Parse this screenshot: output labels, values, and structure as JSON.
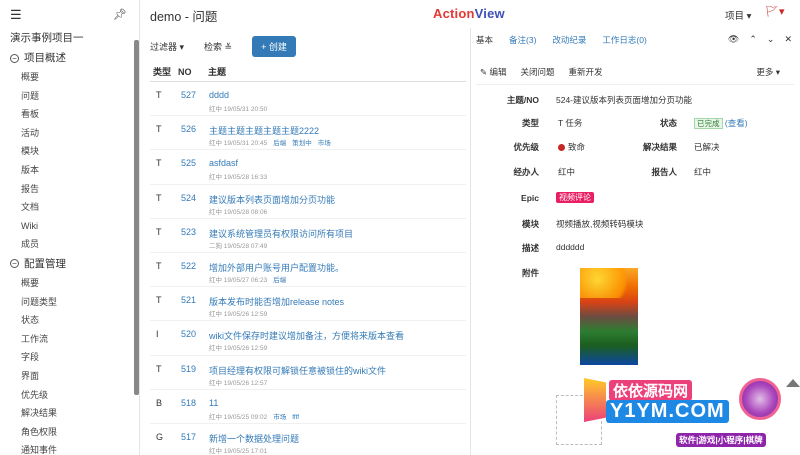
{
  "sidebar": {
    "project_title": "演示事例项目一",
    "sections": [
      {
        "title": "项目概述",
        "items": [
          "概要",
          "问题",
          "看板",
          "活动",
          "模块",
          "版本",
          "报告",
          "文档",
          "Wiki",
          "成员"
        ]
      },
      {
        "title": "配置管理",
        "items": [
          "概要",
          "问题类型",
          "状态",
          "工作流",
          "字段",
          "界面",
          "优先级",
          "解决结果",
          "角色权限",
          "通知事件"
        ]
      }
    ]
  },
  "header": {
    "page_title": "demo - 问题",
    "logo_part1": "Action",
    "logo_part2": "View",
    "project_menu": "项目 ▾"
  },
  "toolbar": {
    "filter": "过滤器 ▾",
    "search": "检索 ≚",
    "create": "+ 创建"
  },
  "list": {
    "headers": {
      "type": "类型",
      "no": "NO",
      "title": "主题"
    },
    "rows": [
      {
        "type": "T",
        "no": "527",
        "title": "dddd",
        "meta": "红中  19/05/31 20:50",
        "labels": []
      },
      {
        "type": "T",
        "no": "526",
        "title": "主题主题主题主题主题2222",
        "meta": "红中  19/05/31 20:45",
        "labels": [
          "后端",
          "策划中",
          "市场"
        ]
      },
      {
        "type": "T",
        "no": "525",
        "title": "asfdasf",
        "meta": "红中  19/05/28 16:33",
        "labels": []
      },
      {
        "type": "T",
        "no": "524",
        "title": "建议版本列表页面增加分页功能",
        "meta": "红中  19/05/28 08:06",
        "labels": []
      },
      {
        "type": "T",
        "no": "523",
        "title": "建议系统管理员有权限访问所有项目",
        "meta": "二狗  19/05/28 07:49",
        "labels": []
      },
      {
        "type": "T",
        "no": "522",
        "title": "增加外部用户账号用户配置功能。",
        "meta": "红中  19/05/27 06:23",
        "labels": [
          "后端"
        ]
      },
      {
        "type": "T",
        "no": "521",
        "title": "版本发布时能否增加release notes",
        "meta": "红中  19/05/26 12:59",
        "labels": []
      },
      {
        "type": "I",
        "no": "520",
        "title": "wiki文件保存时建议增加备注，方便将来版本查看",
        "meta": "红中  19/05/26 12:59",
        "labels": []
      },
      {
        "type": "T",
        "no": "519",
        "title": "项目经理有权限可解锁任意被锁住的wiki文件",
        "meta": "红中  19/05/26 12:57",
        "labels": []
      },
      {
        "type": "B",
        "no": "518",
        "title": "11",
        "meta": "红中  19/05/25 09:02",
        "labels": [
          "市场",
          "ffff"
        ]
      },
      {
        "type": "G",
        "no": "517",
        "title": "新增一个数据处理问题",
        "meta": "红中  19/05/25 17:01",
        "labels": []
      }
    ]
  },
  "detail": {
    "tabs": [
      "基本",
      "备注(3)",
      "改动纪录",
      "工作日志(0)"
    ],
    "actions": [
      "✎ 编辑",
      "关闭问题",
      "重新开发"
    ],
    "more": "更多 ▾",
    "fields": {
      "subject_label": "主题/NO",
      "subject_value": "524-建议版本列表页面增加分页功能",
      "type_label": "类型",
      "type_value": "T  任务",
      "status_label": "状态",
      "status_value": "已完成",
      "status_link": "(查看)",
      "priority_label": "优先级",
      "priority_value": "致命",
      "resolution_label": "解决结果",
      "resolution_value": "已解决",
      "assignee_label": "经办人",
      "assignee_value": "红中",
      "reporter_label": "报告人",
      "reporter_value": "红中",
      "epic_label": "Epic",
      "epic_value": "视频评论",
      "module_label": "模块",
      "module_value": "视频播放,视频转码模块",
      "desc_label": "描述",
      "desc_value": "dddddd",
      "attach_label": "附件"
    }
  },
  "watermark": {
    "line1": "依依源码网",
    "line2": "Y1YM.COM",
    "line3": "软件|游戏|小程序|棋牌"
  }
}
